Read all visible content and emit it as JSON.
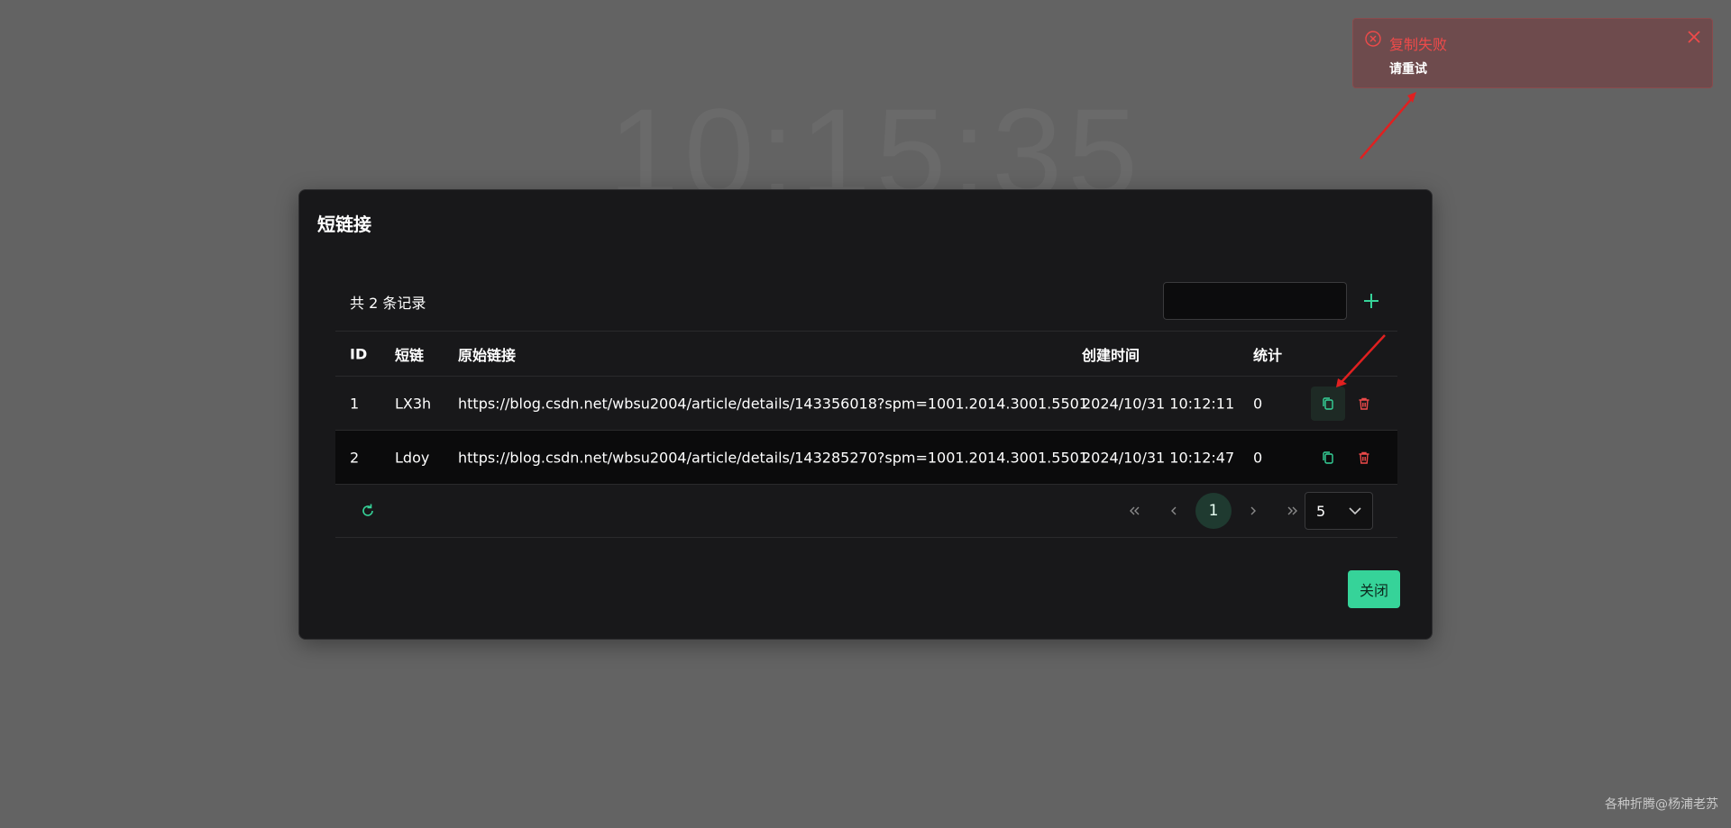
{
  "background": {
    "clock": "10:15:35"
  },
  "dialog": {
    "title": "短链接",
    "total_label": "共 2 条记录",
    "search": {
      "value": "",
      "placeholder": ""
    },
    "table": {
      "headers": {
        "id": "ID",
        "short": "短链",
        "url": "原始链接",
        "time": "创建时间",
        "count": "统计"
      },
      "rows": [
        {
          "id": "1",
          "short": "LX3h",
          "url": "https://blog.csdn.net/wbsu2004/article/details/143356018?spm=1001.2014.3001.5501",
          "time": "2024/10/31 10:12:11",
          "count": "0"
        },
        {
          "id": "2",
          "short": "Ldoy",
          "url": "https://blog.csdn.net/wbsu2004/article/details/143285270?spm=1001.2014.3001.5501",
          "time": "2024/10/31 10:12:47",
          "count": "0"
        }
      ]
    },
    "pagination": {
      "current_page": "1",
      "page_size": "5"
    },
    "close_label": "关闭"
  },
  "toast": {
    "title": "复制失败",
    "message": "请重试"
  },
  "watermark": "各种折腾@杨浦老苏",
  "colors": {
    "accent": "#36d399",
    "danger": "#ef4a4a",
    "dialog_bg": "#18181a",
    "backdrop": "#636363"
  },
  "icons": {
    "add": "plus-icon",
    "copy": "copy-icon",
    "delete": "trash-icon",
    "refresh": "refresh-icon",
    "first": "double-chevron-left-icon",
    "prev": "chevron-left-icon",
    "next": "chevron-right-icon",
    "last": "double-chevron-right-icon",
    "dropdown": "chevron-down-icon",
    "error": "error-circle-icon",
    "close": "close-icon"
  }
}
